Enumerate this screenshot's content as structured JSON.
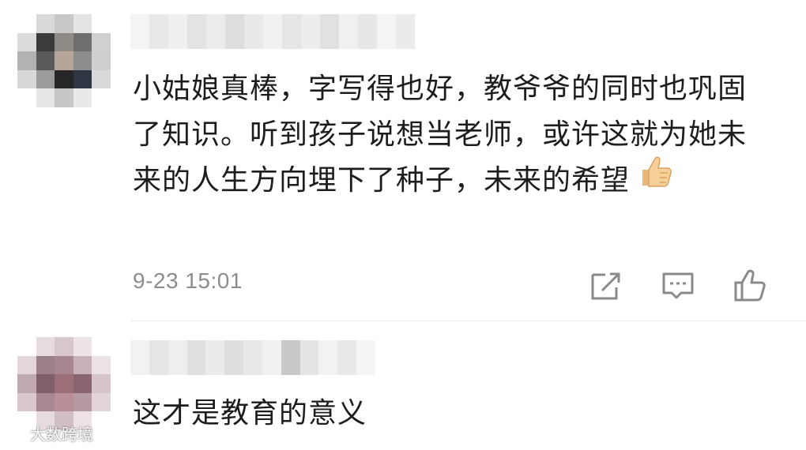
{
  "comments": [
    {
      "text": "小姑娘真棒，字写得也好，教爷爷的同时也巩固了知识。听到孩子说想当老师，或许这就为她未来的人生方向埋下了种子，未来的希望",
      "emoji": "thumbs-up-icon",
      "time": "9-23 15:01"
    },
    {
      "text": "这才是教育的意义"
    }
  ],
  "actions": {
    "share_icon": "share-icon",
    "reply_icon": "comment-icon",
    "like_icon": "like-icon"
  },
  "watermark": "大数跨境",
  "colors": {
    "text": "#1d1d1d",
    "meta": "#8c8c8c",
    "icon": "#8a8a8a",
    "divider": "#ededed"
  }
}
